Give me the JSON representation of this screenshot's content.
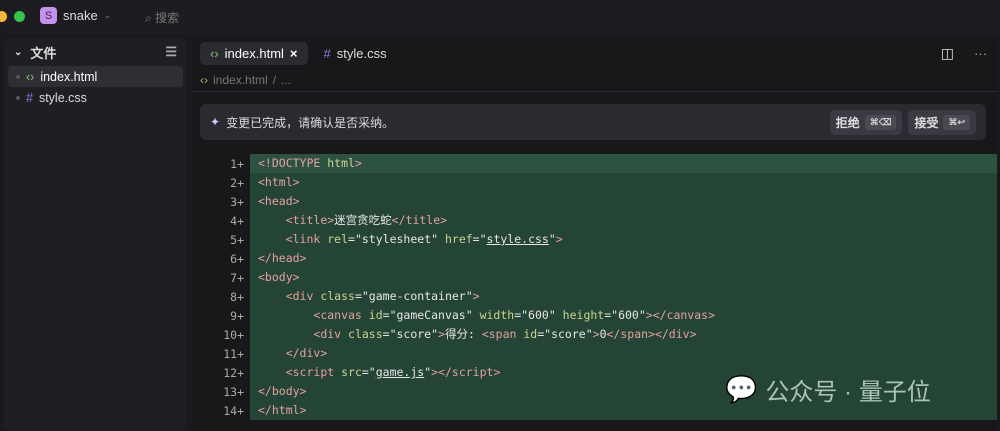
{
  "titlebar": {
    "project_initial": "S",
    "project_name": "snake",
    "search_placeholder": "搜索"
  },
  "sidebar": {
    "title": "文件",
    "files": [
      {
        "icon": "code-icon",
        "name": "index.html",
        "active": true
      },
      {
        "icon": "hash-icon",
        "name": "style.css",
        "active": false
      }
    ]
  },
  "tabs": [
    {
      "label": "index.html",
      "active": true
    },
    {
      "label": "style.css",
      "active": false
    }
  ],
  "breadcrumb": {
    "file": "index.html",
    "more": "..."
  },
  "banner": {
    "message": "变更已完成，请确认是否采纳。",
    "reject": "拒绝",
    "reject_kbd": "⌘⌫",
    "accept": "接受",
    "accept_kbd": "⌘↩"
  },
  "code": {
    "lines": [
      [
        [
          "doc",
          "<!DOCTYPE "
        ],
        [
          "attr",
          "html"
        ],
        [
          "tag",
          ">"
        ]
      ],
      [
        [
          "tag",
          "<html>"
        ]
      ],
      [
        [
          "tag",
          "<head>"
        ]
      ],
      [
        [
          "s",
          "    "
        ],
        [
          "tag",
          "<title>"
        ],
        [
          "s",
          "迷宫贪吃蛇"
        ],
        [
          "tag",
          "</title>"
        ]
      ],
      [
        [
          "s",
          "    "
        ],
        [
          "tag",
          "<link "
        ],
        [
          "attr",
          "rel"
        ],
        [
          "s",
          "=\"stylesheet\" "
        ],
        [
          "attr",
          "href"
        ],
        [
          "s",
          "=\""
        ],
        [
          "link",
          "style.css"
        ],
        [
          "s",
          "\""
        ],
        [
          "tag",
          ">"
        ]
      ],
      [
        [
          "tag",
          "</head>"
        ]
      ],
      [
        [
          "tag",
          "<body>"
        ]
      ],
      [
        [
          "s",
          "    "
        ],
        [
          "tag",
          "<div "
        ],
        [
          "attr",
          "class"
        ],
        [
          "s",
          "=\"game-container\""
        ],
        [
          "tag",
          ">"
        ]
      ],
      [
        [
          "s",
          "        "
        ],
        [
          "tag",
          "<canvas "
        ],
        [
          "attr",
          "id"
        ],
        [
          "s",
          "=\"gameCanvas\" "
        ],
        [
          "attr",
          "width"
        ],
        [
          "s",
          "=\"600\" "
        ],
        [
          "attr",
          "height"
        ],
        [
          "s",
          "=\"600\""
        ],
        [
          "tag",
          "></canvas>"
        ]
      ],
      [
        [
          "s",
          "        "
        ],
        [
          "tag",
          "<div "
        ],
        [
          "attr",
          "class"
        ],
        [
          "s",
          "=\"score\""
        ],
        [
          "tag",
          ">"
        ],
        [
          "s",
          "得分: "
        ],
        [
          "tag",
          "<span "
        ],
        [
          "attr",
          "id"
        ],
        [
          "s",
          "=\"score\""
        ],
        [
          "tag",
          ">"
        ],
        [
          "s",
          "0"
        ],
        [
          "tag",
          "</span></div>"
        ]
      ],
      [
        [
          "s",
          "    "
        ],
        [
          "tag",
          "</div>"
        ]
      ],
      [
        [
          "s",
          "    "
        ],
        [
          "tag",
          "<script "
        ],
        [
          "attr",
          "src"
        ],
        [
          "s",
          "=\""
        ],
        [
          "link",
          "game.js"
        ],
        [
          "s",
          "\""
        ],
        [
          "tag",
          "></script>"
        ]
      ],
      [
        [
          "tag",
          "</body>"
        ]
      ],
      [
        [
          "tag",
          "</html>"
        ]
      ]
    ]
  },
  "watermark": "公众号 · 量子位"
}
